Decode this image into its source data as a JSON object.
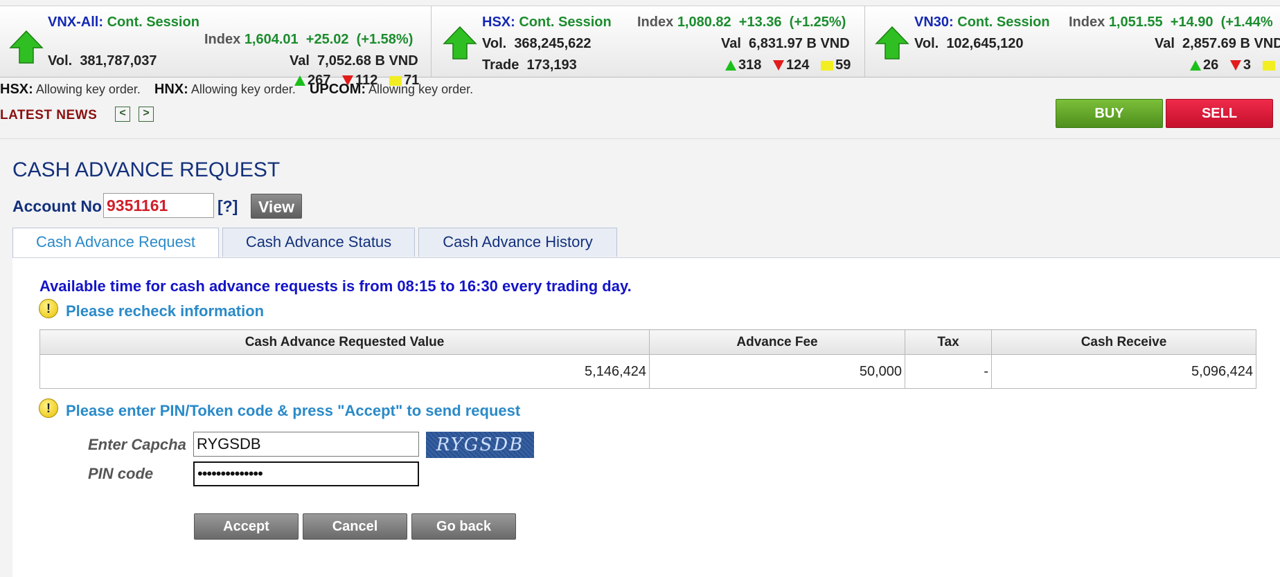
{
  "markets": [
    {
      "name": "VNX-All",
      "session": "Cont. Session",
      "index_label": "Index",
      "index_value": "1,604.01",
      "change": "+25.02",
      "pct": "(+1.58%)",
      "vol_label": "Vol.",
      "vol": "381,787,037",
      "val_label": "Val",
      "val": "7,052.68 B VND",
      "up": "267",
      "down": "112",
      "flat": "71"
    },
    {
      "name": "HSX",
      "session": "Cont. Session",
      "index_label": "Index",
      "index_value": "1,080.82",
      "change": "+13.36",
      "pct": "(+1.25%)",
      "vol_label": "Vol.",
      "vol": "368,245,622",
      "val_label": "Val",
      "val": "6,831.97 B VND",
      "trade_label": "Trade",
      "trade": "173,193",
      "up": "318",
      "down": "124",
      "flat": "59"
    },
    {
      "name": "VN30",
      "session": "Cont. Session",
      "index_label": "Index",
      "index_value": "1,051.55",
      "change": "+14.90",
      "pct": "(+1.44%",
      "vol_label": "Vol.",
      "vol": "102,645,120",
      "val_label": "Val",
      "val": "2,857.69 B VND",
      "up": "26",
      "down": "3"
    }
  ],
  "status": [
    {
      "exchange": "HSX:",
      "text": "Allowing key order."
    },
    {
      "exchange": "HNX:",
      "text": "Allowing key order."
    },
    {
      "exchange": "UPCOM:",
      "text": "Allowing key order."
    }
  ],
  "news": {
    "label": "LATEST NEWS",
    "prev": "<",
    "next": ">"
  },
  "actions": {
    "buy": "BUY",
    "sell": "SELL"
  },
  "page": {
    "title": "CASH ADVANCE REQUEST",
    "account_label": "Account No",
    "account_value": "9351161",
    "help": "[?]",
    "view": "View"
  },
  "tabs": [
    {
      "label": "Cash Advance Request",
      "active": true
    },
    {
      "label": "Cash Advance Status",
      "active": false
    },
    {
      "label": "Cash Advance History",
      "active": false
    }
  ],
  "content": {
    "availability": "Available time for cash advance requests is from 08:15 to 16:30 every trading day.",
    "recheck": "Please recheck information",
    "warn_glyph": "!",
    "table": {
      "headers": [
        "Cash Advance Requested Value",
        "Advance Fee",
        "Tax",
        "Cash Receive"
      ],
      "row": [
        "5,146,424",
        "50,000",
        "-",
        "5,096,424"
      ]
    },
    "pin_note": "Please enter PIN/Token code & press \"Accept\" to send request",
    "captcha_label": "Enter Capcha",
    "captcha_value": "RYGSDB",
    "captcha_image_text": "RYGSDB",
    "pin_label": "PIN code",
    "pin_value": "••••••••••••••",
    "buttons": {
      "accept": "Accept",
      "cancel": "Cancel",
      "back": "Go back"
    }
  },
  "colors": {
    "accent_blue": "#13307a",
    "link_blue": "#2a8ac8",
    "green": "#1c8c2e",
    "red": "#d0202a"
  },
  "icons": {
    "market_up": "green-up-arrow-icon",
    "warning": "warning-icon"
  }
}
